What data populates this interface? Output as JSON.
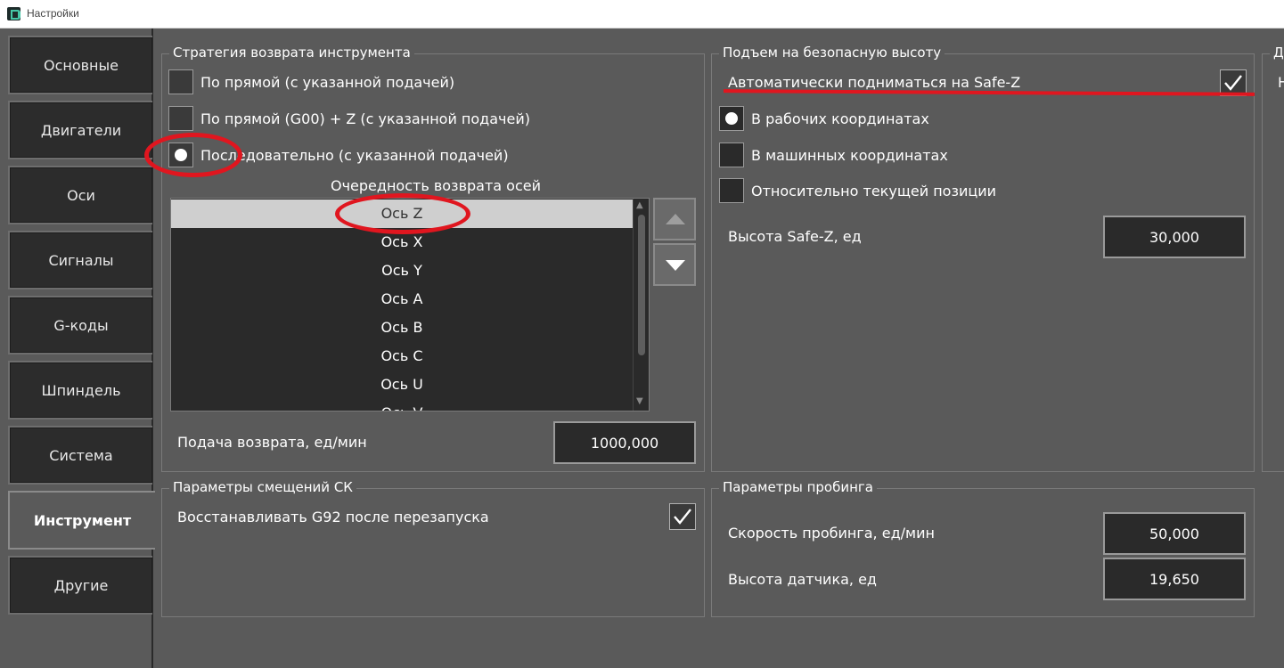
{
  "window": {
    "title": "Настройки"
  },
  "sidebar": {
    "items": [
      {
        "label": "Основные"
      },
      {
        "label": "Двигатели"
      },
      {
        "label": "Оси"
      },
      {
        "label": "Сигналы"
      },
      {
        "label": "G-коды"
      },
      {
        "label": "Шпиндель"
      },
      {
        "label": "Система"
      },
      {
        "label": "Инструмент",
        "active": true
      },
      {
        "label": "Другие"
      }
    ]
  },
  "return_strategy": {
    "title": "Стратегия возврата инструмента",
    "options": [
      {
        "label": "По прямой (с указанной подачей)",
        "checked": false
      },
      {
        "label": "По прямой (G00) + Z (с указанной подачей)",
        "checked": false
      },
      {
        "label": "Последовательно (с указанной подачей)",
        "checked": true
      }
    ],
    "axis_order_title": "Очередность возврата осей",
    "axis_order": [
      "Ось Z",
      "Ось X",
      "Ось Y",
      "Ось A",
      "Ось B",
      "Ось C",
      "Ось U",
      "Ось V"
    ],
    "selected_axis": "Ось Z",
    "feed_label": "Подача возврата, ед/мин",
    "feed_value": "1000,000"
  },
  "safe_height": {
    "title": "Подъем на безопасную высоту",
    "auto_label": "Автоматически подниматься на Safe-Z",
    "auto_checked": true,
    "options": [
      {
        "label": "В рабочих координатах",
        "checked": true
      },
      {
        "label": "В машинных координатах",
        "checked": false
      },
      {
        "label": "Относительно текущей позиции",
        "checked": false
      }
    ],
    "height_label": "Высота Safe-Z, ед",
    "height_value": "30,000"
  },
  "offsets": {
    "title": "Параметры смещений СК",
    "restore_label": "Восстанавливать G92 после перезапуска",
    "restore_checked": true
  },
  "probing": {
    "title": "Параметры пробинга",
    "speed_label": "Скорость пробинга, ед/мин",
    "speed_value": "50,000",
    "sensor_label": "Высота датчика, ед",
    "sensor_value": "19,650"
  },
  "partial_panel": {
    "title": "Д",
    "row": "Н"
  },
  "colors": {
    "background": "#5a5a5a",
    "field": "#2a2a2a",
    "annotation": "#e0161f"
  }
}
